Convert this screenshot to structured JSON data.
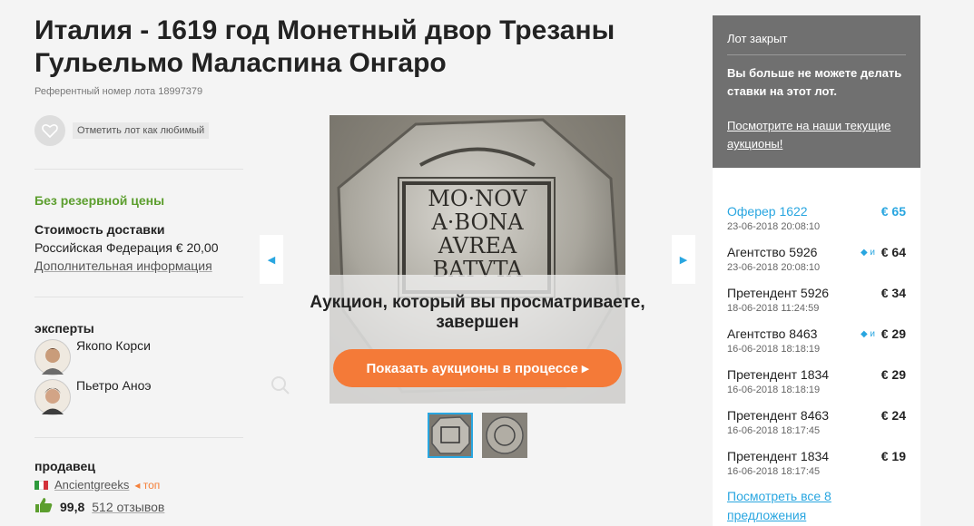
{
  "lot": {
    "title": "Италия - 1619 год Монетный двор Трезаны Гульельмо Маласпина Онгаро",
    "reference": "Референтный номер лота 18997379",
    "favorite_label": "Отметить лот как любимый"
  },
  "info": {
    "no_reserve": "Без резервной цены",
    "shipping_heading": "Стоимость доставки",
    "shipping_value": "Российская Федерация € 20,00",
    "shipping_more": "Дополнительная информация"
  },
  "experts": {
    "heading": "эксперты",
    "list": [
      "Якопо Корси",
      "Пьетро Аноэ"
    ]
  },
  "seller": {
    "heading": "продавец",
    "name": "Ancientgreeks",
    "badge": "◂ топ",
    "rating": "99,8",
    "reviews": "512 отзывов"
  },
  "viewer": {
    "coin_lines": [
      "MO·NOV",
      "A·BONA",
      "AVREA",
      "BATVTA"
    ],
    "ended_text": "Аукцион, который вы просматриваете, завершен",
    "show_button": "Показать аукционы в процессе ▸"
  },
  "sidebar": {
    "closed_label": "Лот закрыт",
    "no_more_bids": "Вы больше не можете делать ставки на этот лот.",
    "current_link": "Посмотрите на наши текущие аукционы!",
    "all_link": "Посмотреть все 8 предложения",
    "bids": [
      {
        "bidder": "Оферер 1622",
        "date": "23-06-2018 20:08:10",
        "amount": "€ 65",
        "auto": "",
        "lead": true
      },
      {
        "bidder": "Агентство 5926",
        "date": "23-06-2018 20:08:10",
        "amount": "€ 64",
        "auto": "◆ и",
        "lead": false
      },
      {
        "bidder": "Претендент 5926",
        "date": "18-06-2018 11:24:59",
        "amount": "€ 34",
        "auto": "",
        "lead": false
      },
      {
        "bidder": "Агентство 8463",
        "date": "16-06-2018 18:18:19",
        "amount": "€ 29",
        "auto": "◆ и",
        "lead": false
      },
      {
        "bidder": "Претендент 1834",
        "date": "16-06-2018 18:18:19",
        "amount": "€ 29",
        "auto": "",
        "lead": false
      },
      {
        "bidder": "Претендент 8463",
        "date": "16-06-2018 18:17:45",
        "amount": "€ 24",
        "auto": "",
        "lead": false
      },
      {
        "bidder": "Претендент 1834",
        "date": "16-06-2018 18:17:45",
        "amount": "€ 19",
        "auto": "",
        "lead": false
      }
    ]
  },
  "colors": {
    "accent_blue": "#29a6e0",
    "accent_orange": "#f47a38",
    "accent_green": "#5c9e2e",
    "sidebar_gray": "#707070"
  },
  "icons": [
    "heart-icon",
    "zoom-icon",
    "thumbs-up-icon",
    "italy-flag-icon",
    "arrow-left-icon",
    "arrow-right-icon"
  ]
}
